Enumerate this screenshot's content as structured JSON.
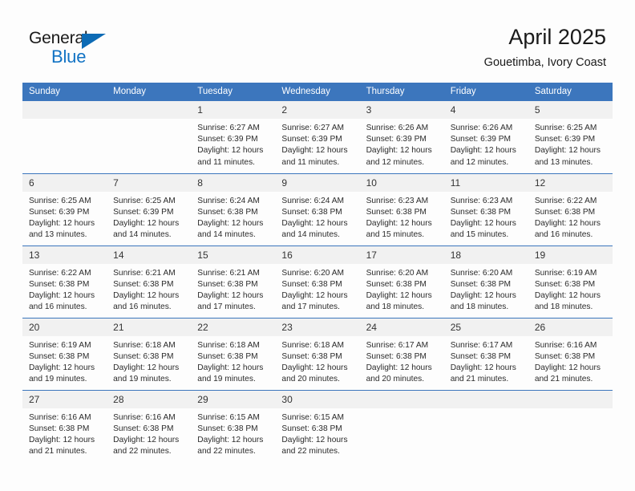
{
  "brand": {
    "name_top": "General",
    "name_bottom": "Blue",
    "accent_color": "#1273c4",
    "triangle_color": "#0d6bb5"
  },
  "header": {
    "title": "April 2025",
    "subtitle": "Gouetimba, Ivory Coast"
  },
  "theme": {
    "header_blue": "#3c76bd",
    "daynum_band": "#f1f1f1",
    "page_background": "#fdfdfd",
    "text_color": "#2b2b2b"
  },
  "calendar": {
    "weekday_headers": [
      "Sunday",
      "Monday",
      "Tuesday",
      "Wednesday",
      "Thursday",
      "Friday",
      "Saturday"
    ],
    "labels": {
      "sunrise": "Sunrise:",
      "sunset": "Sunset:",
      "daylight": "Daylight:"
    },
    "weeks": [
      [
        {
          "day": "",
          "sunrise": "",
          "sunset": "",
          "daylight_line1": "",
          "daylight_line2": ""
        },
        {
          "day": "",
          "sunrise": "",
          "sunset": "",
          "daylight_line1": "",
          "daylight_line2": ""
        },
        {
          "day": "1",
          "sunrise": "Sunrise: 6:27 AM",
          "sunset": "Sunset: 6:39 PM",
          "daylight_line1": "Daylight: 12 hours",
          "daylight_line2": "and 11 minutes."
        },
        {
          "day": "2",
          "sunrise": "Sunrise: 6:27 AM",
          "sunset": "Sunset: 6:39 PM",
          "daylight_line1": "Daylight: 12 hours",
          "daylight_line2": "and 11 minutes."
        },
        {
          "day": "3",
          "sunrise": "Sunrise: 6:26 AM",
          "sunset": "Sunset: 6:39 PM",
          "daylight_line1": "Daylight: 12 hours",
          "daylight_line2": "and 12 minutes."
        },
        {
          "day": "4",
          "sunrise": "Sunrise: 6:26 AM",
          "sunset": "Sunset: 6:39 PM",
          "daylight_line1": "Daylight: 12 hours",
          "daylight_line2": "and 12 minutes."
        },
        {
          "day": "5",
          "sunrise": "Sunrise: 6:25 AM",
          "sunset": "Sunset: 6:39 PM",
          "daylight_line1": "Daylight: 12 hours",
          "daylight_line2": "and 13 minutes."
        }
      ],
      [
        {
          "day": "6",
          "sunrise": "Sunrise: 6:25 AM",
          "sunset": "Sunset: 6:39 PM",
          "daylight_line1": "Daylight: 12 hours",
          "daylight_line2": "and 13 minutes."
        },
        {
          "day": "7",
          "sunrise": "Sunrise: 6:25 AM",
          "sunset": "Sunset: 6:39 PM",
          "daylight_line1": "Daylight: 12 hours",
          "daylight_line2": "and 14 minutes."
        },
        {
          "day": "8",
          "sunrise": "Sunrise: 6:24 AM",
          "sunset": "Sunset: 6:38 PM",
          "daylight_line1": "Daylight: 12 hours",
          "daylight_line2": "and 14 minutes."
        },
        {
          "day": "9",
          "sunrise": "Sunrise: 6:24 AM",
          "sunset": "Sunset: 6:38 PM",
          "daylight_line1": "Daylight: 12 hours",
          "daylight_line2": "and 14 minutes."
        },
        {
          "day": "10",
          "sunrise": "Sunrise: 6:23 AM",
          "sunset": "Sunset: 6:38 PM",
          "daylight_line1": "Daylight: 12 hours",
          "daylight_line2": "and 15 minutes."
        },
        {
          "day": "11",
          "sunrise": "Sunrise: 6:23 AM",
          "sunset": "Sunset: 6:38 PM",
          "daylight_line1": "Daylight: 12 hours",
          "daylight_line2": "and 15 minutes."
        },
        {
          "day": "12",
          "sunrise": "Sunrise: 6:22 AM",
          "sunset": "Sunset: 6:38 PM",
          "daylight_line1": "Daylight: 12 hours",
          "daylight_line2": "and 16 minutes."
        }
      ],
      [
        {
          "day": "13",
          "sunrise": "Sunrise: 6:22 AM",
          "sunset": "Sunset: 6:38 PM",
          "daylight_line1": "Daylight: 12 hours",
          "daylight_line2": "and 16 minutes."
        },
        {
          "day": "14",
          "sunrise": "Sunrise: 6:21 AM",
          "sunset": "Sunset: 6:38 PM",
          "daylight_line1": "Daylight: 12 hours",
          "daylight_line2": "and 16 minutes."
        },
        {
          "day": "15",
          "sunrise": "Sunrise: 6:21 AM",
          "sunset": "Sunset: 6:38 PM",
          "daylight_line1": "Daylight: 12 hours",
          "daylight_line2": "and 17 minutes."
        },
        {
          "day": "16",
          "sunrise": "Sunrise: 6:20 AM",
          "sunset": "Sunset: 6:38 PM",
          "daylight_line1": "Daylight: 12 hours",
          "daylight_line2": "and 17 minutes."
        },
        {
          "day": "17",
          "sunrise": "Sunrise: 6:20 AM",
          "sunset": "Sunset: 6:38 PM",
          "daylight_line1": "Daylight: 12 hours",
          "daylight_line2": "and 18 minutes."
        },
        {
          "day": "18",
          "sunrise": "Sunrise: 6:20 AM",
          "sunset": "Sunset: 6:38 PM",
          "daylight_line1": "Daylight: 12 hours",
          "daylight_line2": "and 18 minutes."
        },
        {
          "day": "19",
          "sunrise": "Sunrise: 6:19 AM",
          "sunset": "Sunset: 6:38 PM",
          "daylight_line1": "Daylight: 12 hours",
          "daylight_line2": "and 18 minutes."
        }
      ],
      [
        {
          "day": "20",
          "sunrise": "Sunrise: 6:19 AM",
          "sunset": "Sunset: 6:38 PM",
          "daylight_line1": "Daylight: 12 hours",
          "daylight_line2": "and 19 minutes."
        },
        {
          "day": "21",
          "sunrise": "Sunrise: 6:18 AM",
          "sunset": "Sunset: 6:38 PM",
          "daylight_line1": "Daylight: 12 hours",
          "daylight_line2": "and 19 minutes."
        },
        {
          "day": "22",
          "sunrise": "Sunrise: 6:18 AM",
          "sunset": "Sunset: 6:38 PM",
          "daylight_line1": "Daylight: 12 hours",
          "daylight_line2": "and 19 minutes."
        },
        {
          "day": "23",
          "sunrise": "Sunrise: 6:18 AM",
          "sunset": "Sunset: 6:38 PM",
          "daylight_line1": "Daylight: 12 hours",
          "daylight_line2": "and 20 minutes."
        },
        {
          "day": "24",
          "sunrise": "Sunrise: 6:17 AM",
          "sunset": "Sunset: 6:38 PM",
          "daylight_line1": "Daylight: 12 hours",
          "daylight_line2": "and 20 minutes."
        },
        {
          "day": "25",
          "sunrise": "Sunrise: 6:17 AM",
          "sunset": "Sunset: 6:38 PM",
          "daylight_line1": "Daylight: 12 hours",
          "daylight_line2": "and 21 minutes."
        },
        {
          "day": "26",
          "sunrise": "Sunrise: 6:16 AM",
          "sunset": "Sunset: 6:38 PM",
          "daylight_line1": "Daylight: 12 hours",
          "daylight_line2": "and 21 minutes."
        }
      ],
      [
        {
          "day": "27",
          "sunrise": "Sunrise: 6:16 AM",
          "sunset": "Sunset: 6:38 PM",
          "daylight_line1": "Daylight: 12 hours",
          "daylight_line2": "and 21 minutes."
        },
        {
          "day": "28",
          "sunrise": "Sunrise: 6:16 AM",
          "sunset": "Sunset: 6:38 PM",
          "daylight_line1": "Daylight: 12 hours",
          "daylight_line2": "and 22 minutes."
        },
        {
          "day": "29",
          "sunrise": "Sunrise: 6:15 AM",
          "sunset": "Sunset: 6:38 PM",
          "daylight_line1": "Daylight: 12 hours",
          "daylight_line2": "and 22 minutes."
        },
        {
          "day": "30",
          "sunrise": "Sunrise: 6:15 AM",
          "sunset": "Sunset: 6:38 PM",
          "daylight_line1": "Daylight: 12 hours",
          "daylight_line2": "and 22 minutes."
        },
        {
          "day": "",
          "sunrise": "",
          "sunset": "",
          "daylight_line1": "",
          "daylight_line2": ""
        },
        {
          "day": "",
          "sunrise": "",
          "sunset": "",
          "daylight_line1": "",
          "daylight_line2": ""
        },
        {
          "day": "",
          "sunrise": "",
          "sunset": "",
          "daylight_line1": "",
          "daylight_line2": ""
        }
      ]
    ]
  }
}
